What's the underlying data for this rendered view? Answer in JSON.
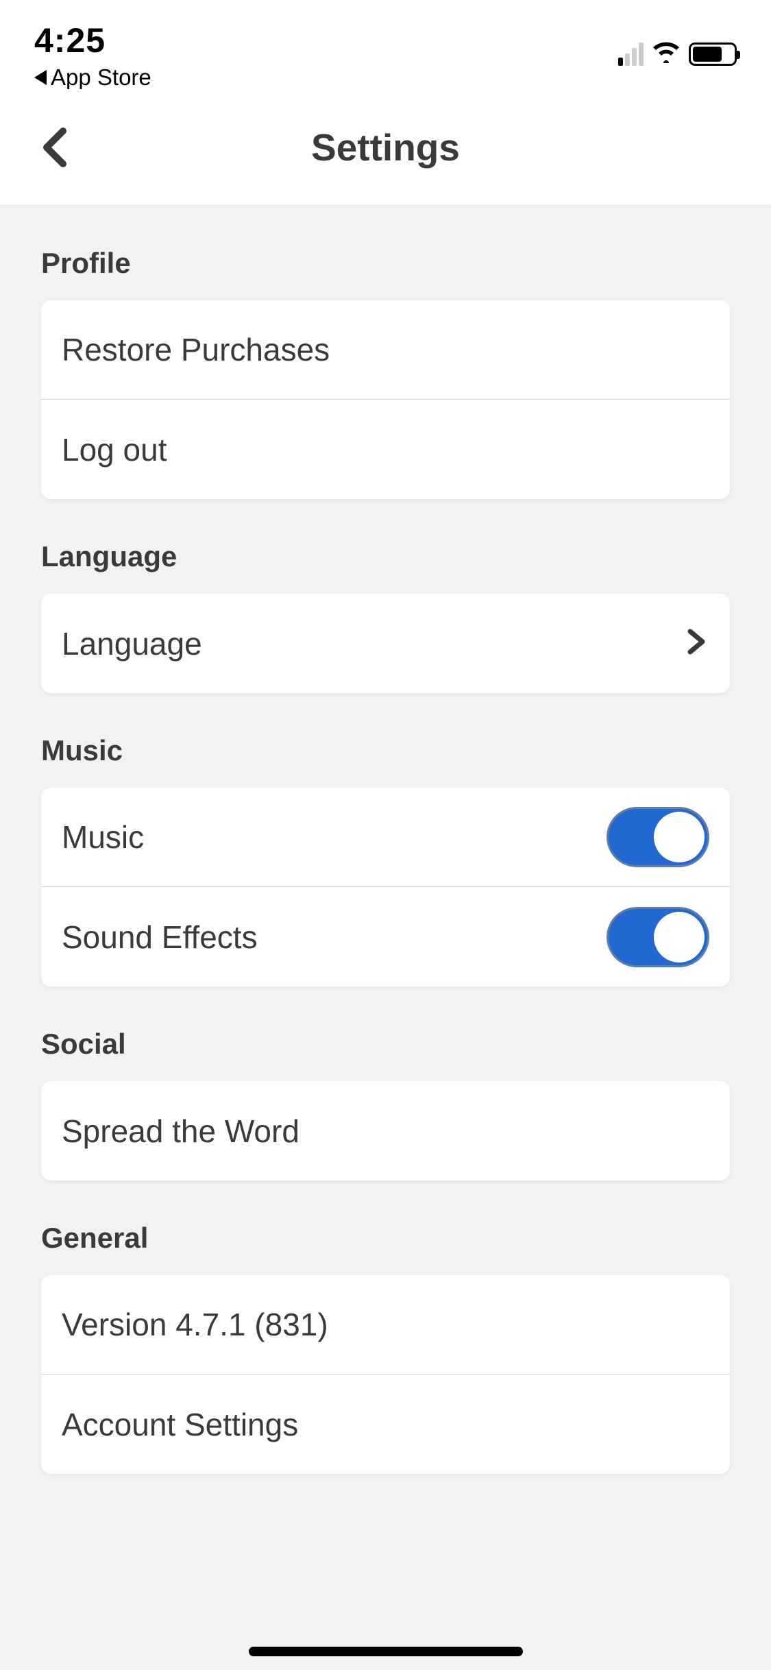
{
  "status": {
    "time": "4:25",
    "breadcrumb": "App Store"
  },
  "nav": {
    "title": "Settings"
  },
  "sections": {
    "profile": {
      "header": "Profile",
      "restore": "Restore Purchases",
      "logout": "Log out"
    },
    "language": {
      "header": "Language",
      "item": "Language"
    },
    "music": {
      "header": "Music",
      "music": "Music",
      "sound_effects": "Sound Effects",
      "music_on": true,
      "sound_on": true
    },
    "social": {
      "header": "Social",
      "spread": "Spread the Word"
    },
    "general": {
      "header": "General",
      "version": "Version 4.7.1 (831)",
      "account": "Account Settings"
    }
  }
}
